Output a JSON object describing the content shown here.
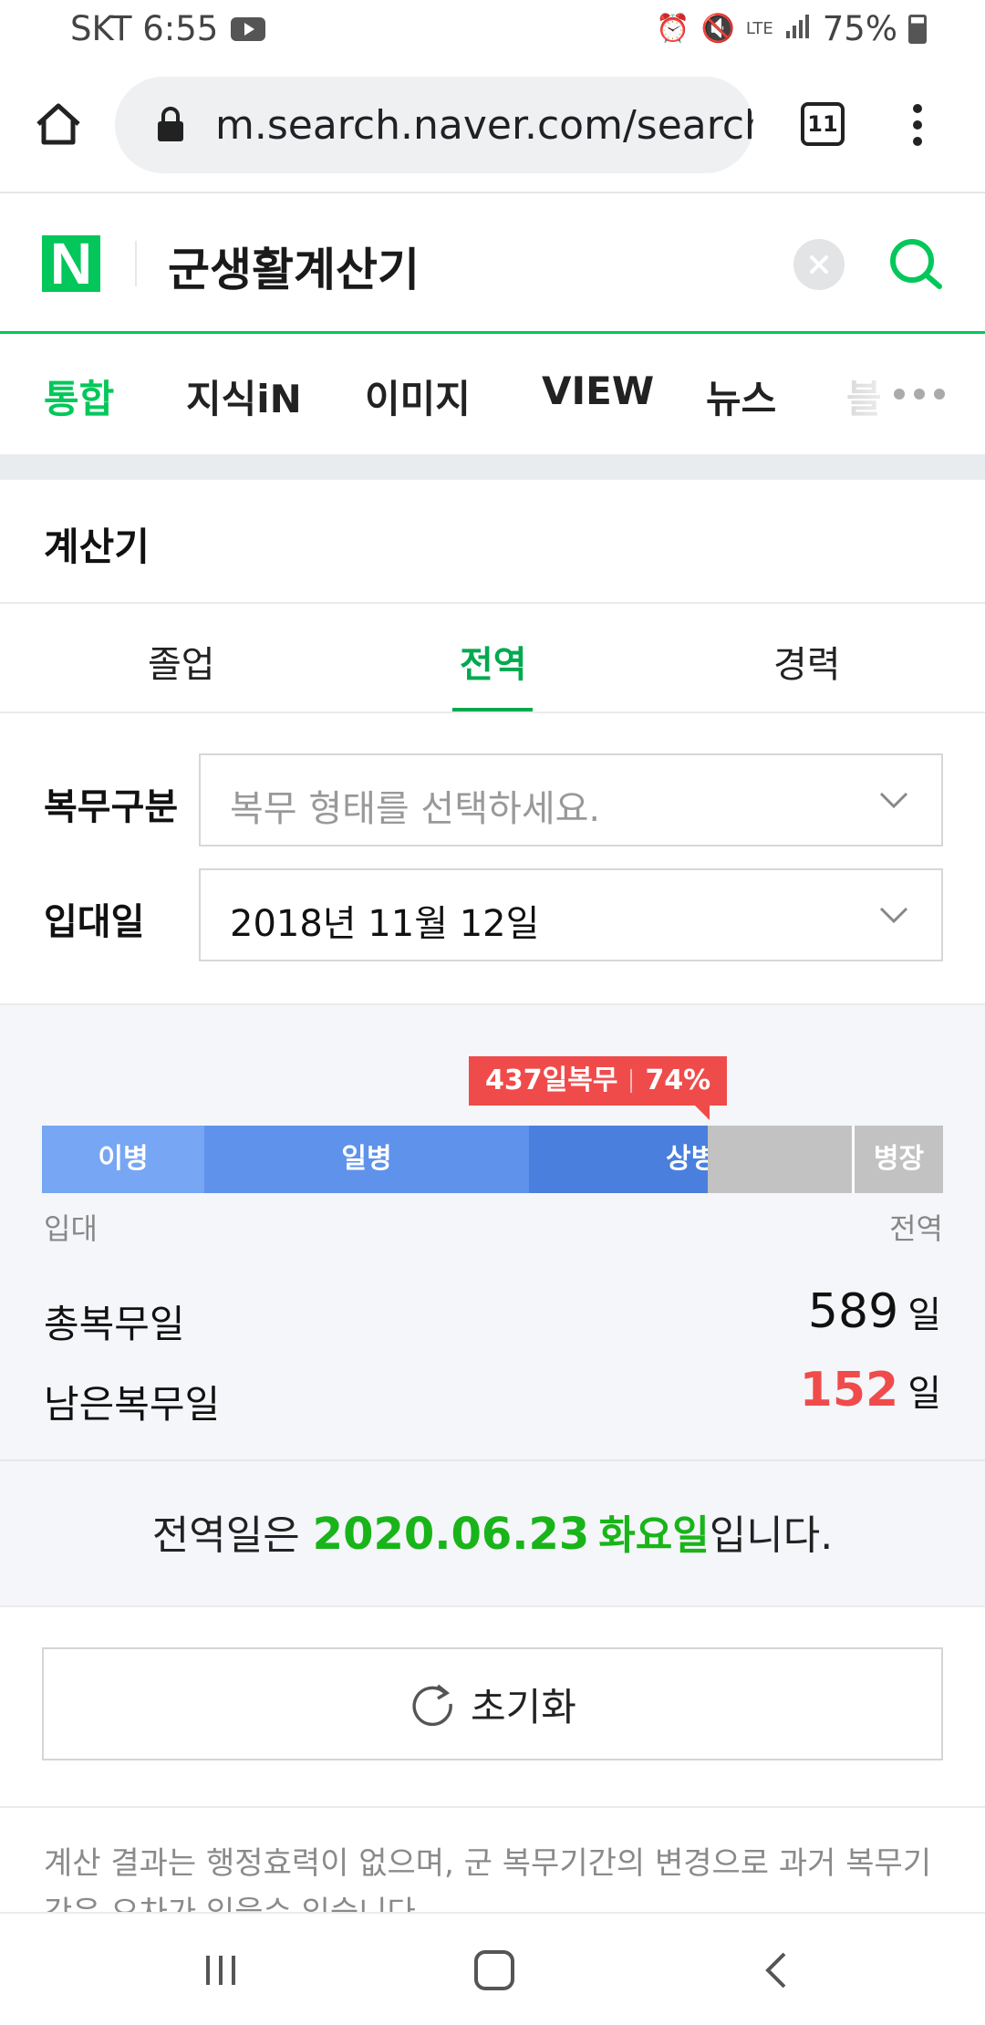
{
  "status_bar": {
    "carrier_time": "SKT 6:55",
    "network": "LTE",
    "battery": "75%"
  },
  "browser": {
    "url": "m.search.naver.com/search.naver?where=m",
    "tab_count": "11"
  },
  "search": {
    "logo": "N",
    "query": "군생활계산기"
  },
  "category_tabs": [
    {
      "label": "통합",
      "active": true
    },
    {
      "label": "지식iN"
    },
    {
      "label": "이미지"
    },
    {
      "label": "VIEW"
    },
    {
      "label": "뉴스"
    },
    {
      "label": "블"
    }
  ],
  "calculator": {
    "title": "계산기",
    "sub_tabs": [
      {
        "label": "졸업"
      },
      {
        "label": "전역",
        "active": true
      },
      {
        "label": "경력"
      }
    ],
    "service_type": {
      "label": "복무구분",
      "placeholder": "복무 형태를 선택하세요."
    },
    "enlistment_date": {
      "label": "입대일",
      "value": "2018년 11월 12일"
    },
    "progress": {
      "badge_days": "437일복무",
      "badge_percent": "74%",
      "fraction": 0.74,
      "ranks": [
        "이병",
        "일병",
        "상병",
        "병장"
      ],
      "start_label": "입대",
      "end_label": "전역"
    },
    "total_days": {
      "label": "총복무일",
      "value": "589",
      "unit": "일"
    },
    "remaining_days": {
      "label": "남은복무일",
      "value": "152",
      "unit": "일"
    },
    "discharge": {
      "prefix": "전역일은 ",
      "date": "2020.06.23",
      "weekday": "화요일",
      "suffix": "입니다."
    },
    "reset_label": "초기화",
    "notice": "계산 결과는 행정효력이 없으며, 군 복무기간의 변경으로 과거 복무기간은 오차가 있을수 있습니다."
  },
  "colors": {
    "naver_green": "#03c75a",
    "accent_red": "#f04b4b",
    "discharge_green": "#19b419"
  }
}
